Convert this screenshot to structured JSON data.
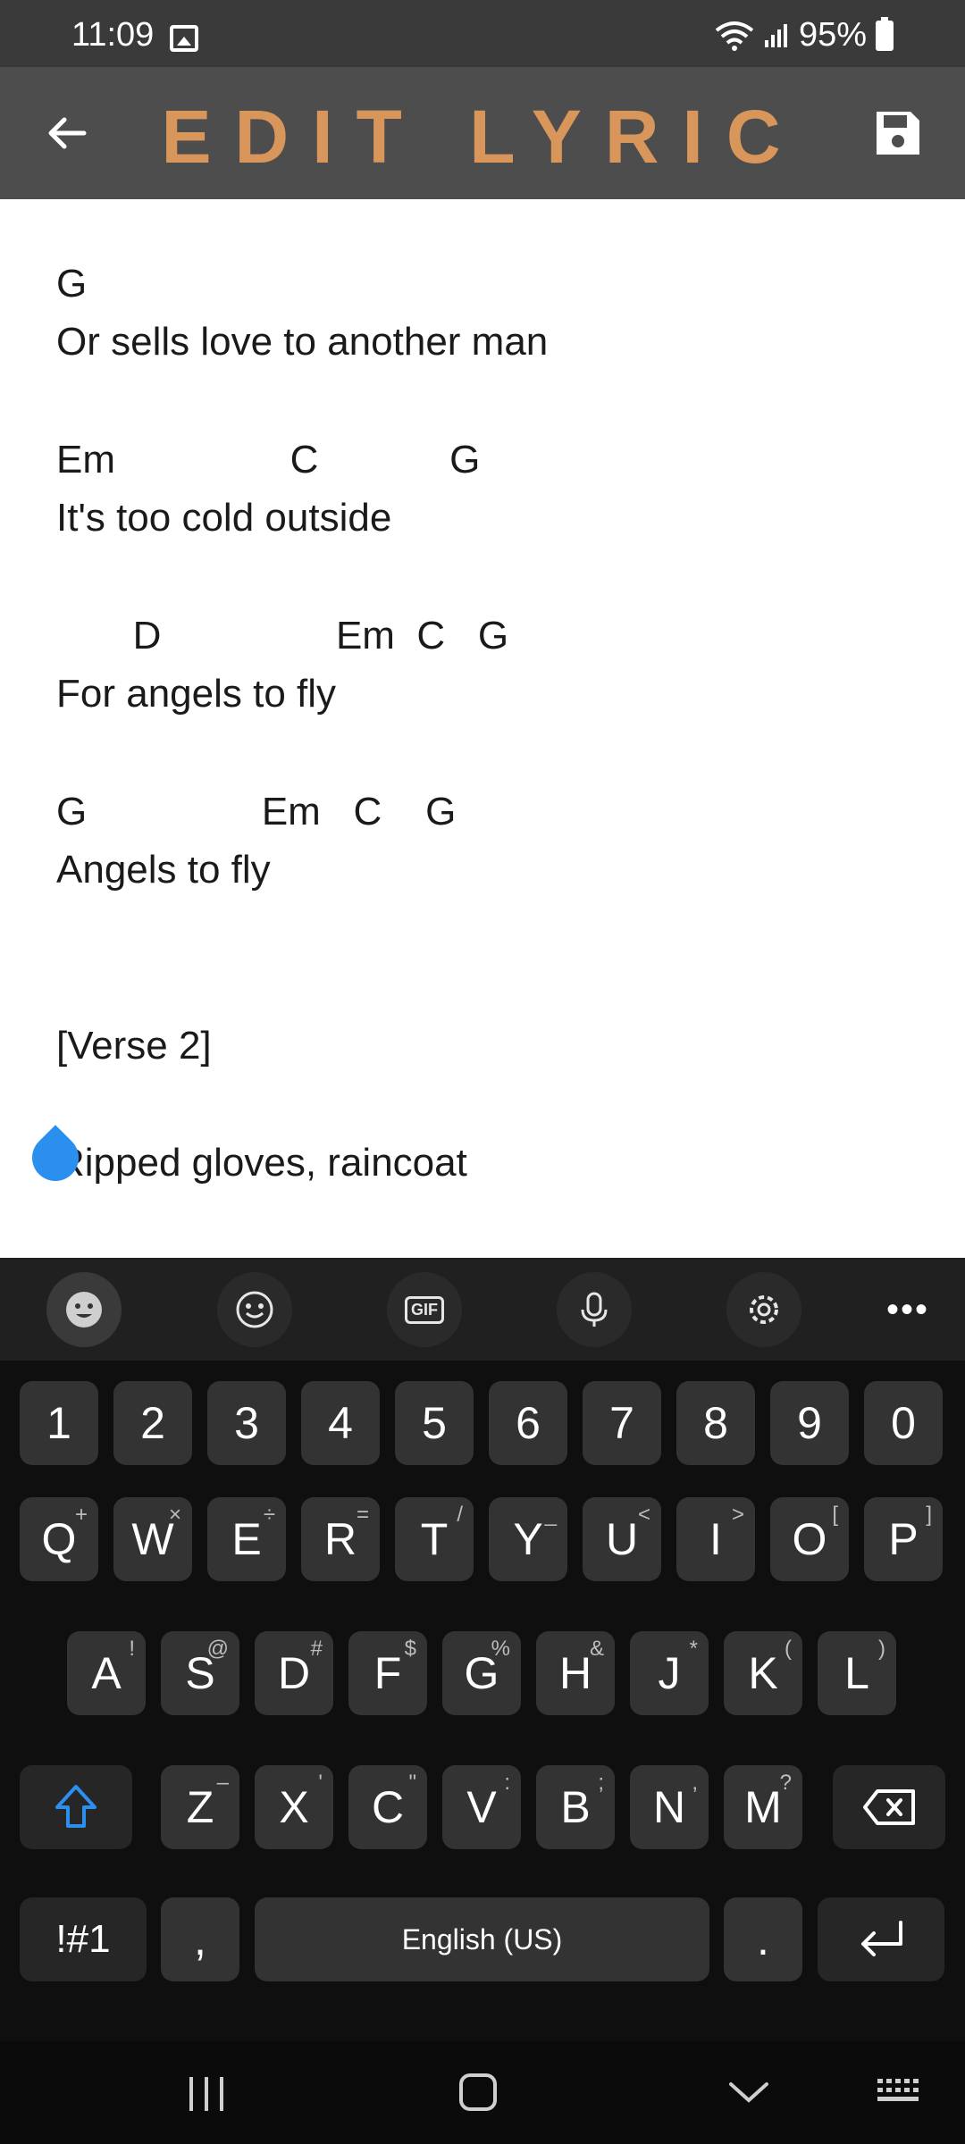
{
  "status": {
    "time": "11:09",
    "battery": "95%"
  },
  "app": {
    "title": "EDIT LYRIC"
  },
  "lyrics": [
    "G",
    "Or sells love to another man",
    "Em                C            G",
    "It's too cold outside",
    "       D                Em  C   G",
    "For angels to fly",
    "G                Em   C    G",
    "Angels to fly",
    "[Verse 2]",
    "Ripped gloves, raincoat"
  ],
  "keyboard": {
    "toolbar": [
      "sticker-icon",
      "emoji-icon",
      "gif-icon",
      "mic-icon",
      "settings-icon",
      "more-icon"
    ],
    "gif_label": "GIF",
    "numbers": [
      "1",
      "2",
      "3",
      "4",
      "5",
      "6",
      "7",
      "8",
      "9",
      "0"
    ],
    "row_q": [
      {
        "k": "Q",
        "s": "+"
      },
      {
        "k": "W",
        "s": "×"
      },
      {
        "k": "E",
        "s": "÷"
      },
      {
        "k": "R",
        "s": "="
      },
      {
        "k": "T",
        "s": "/"
      },
      {
        "k": "Y",
        "s": "_"
      },
      {
        "k": "U",
        "s": "<"
      },
      {
        "k": "I",
        "s": ">"
      },
      {
        "k": "O",
        "s": "["
      },
      {
        "k": "P",
        "s": "]"
      }
    ],
    "row_a": [
      {
        "k": "A",
        "s": "!"
      },
      {
        "k": "S",
        "s": "@"
      },
      {
        "k": "D",
        "s": "#"
      },
      {
        "k": "F",
        "s": "$"
      },
      {
        "k": "G",
        "s": "%"
      },
      {
        "k": "H",
        "s": "&"
      },
      {
        "k": "J",
        "s": "*"
      },
      {
        "k": "K",
        "s": "("
      },
      {
        "k": "L",
        "s": ")"
      }
    ],
    "row_z": [
      {
        "k": "Z",
        "s": "–"
      },
      {
        "k": "X",
        "s": "'"
      },
      {
        "k": "C",
        "s": "\""
      },
      {
        "k": "V",
        "s": ":"
      },
      {
        "k": "B",
        "s": ";"
      },
      {
        "k": "N",
        "s": ","
      },
      {
        "k": "M",
        "s": "?"
      }
    ],
    "symbols_label": "!#1",
    "comma": ",",
    "space_label": "English (US)",
    "period": "."
  },
  "colors": {
    "accent": "#d9965a",
    "cursor": "#2b8ff0",
    "shift": "#2b8ff0"
  }
}
